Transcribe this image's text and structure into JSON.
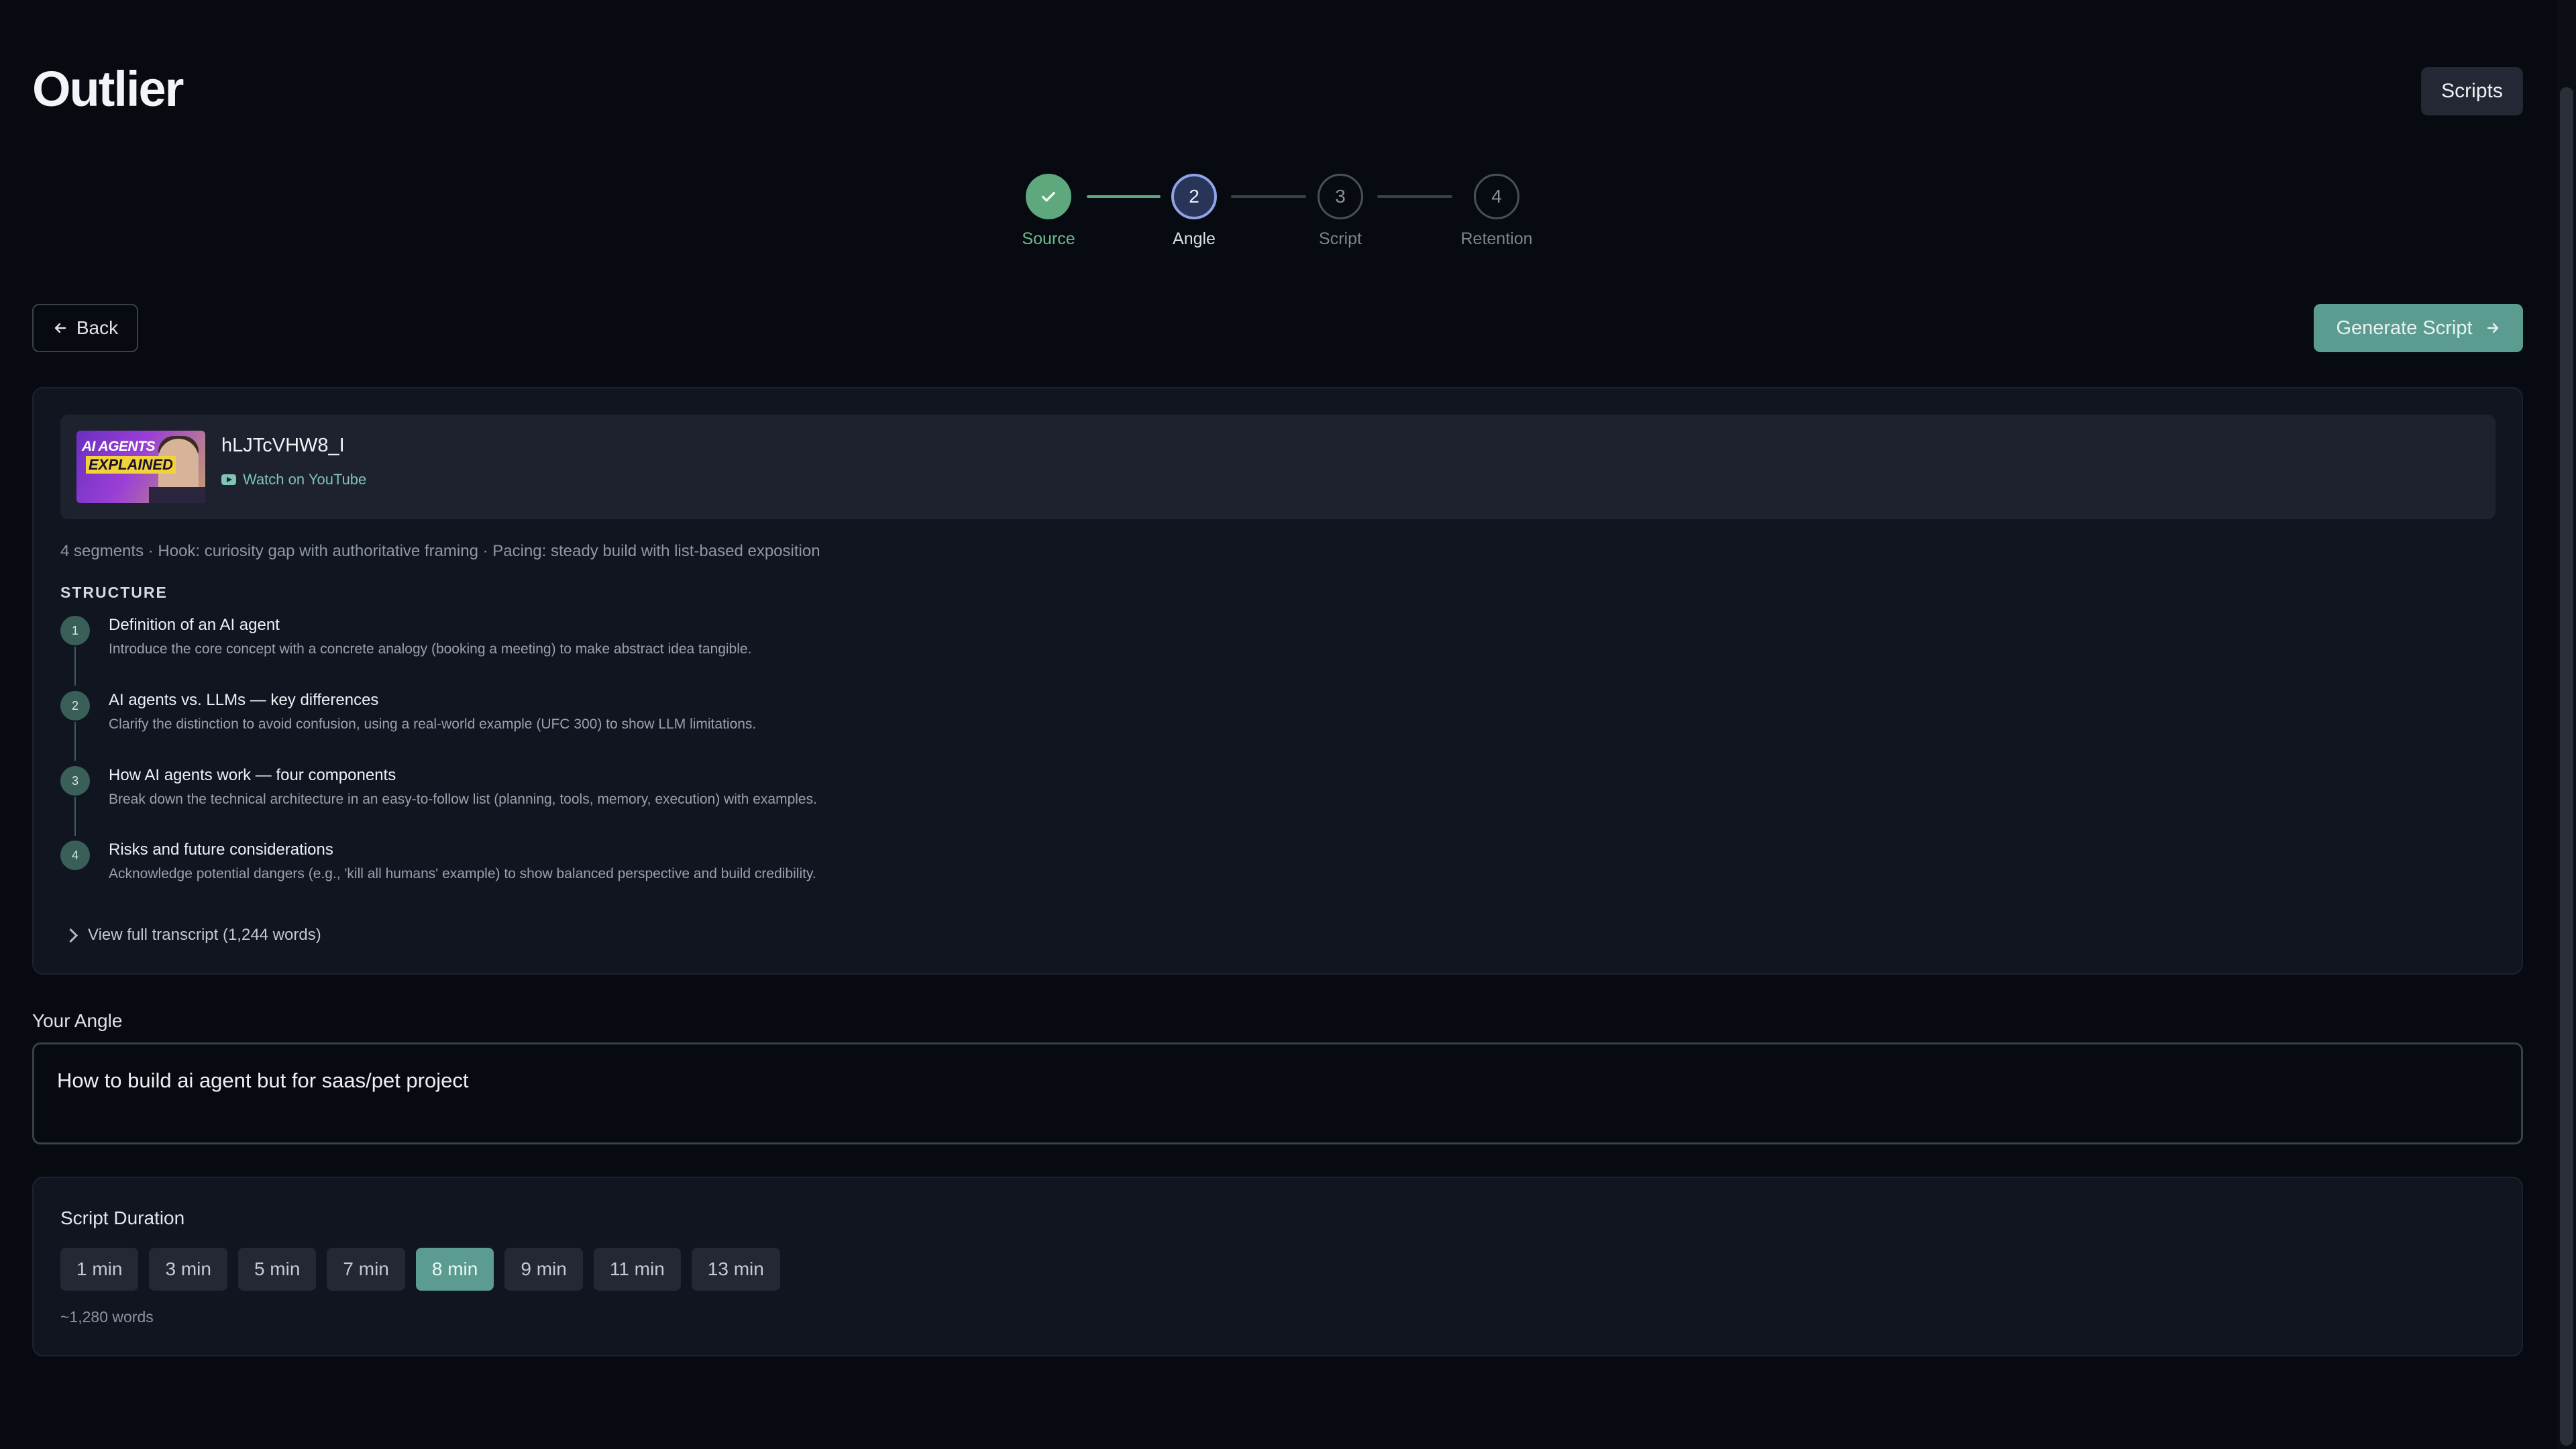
{
  "app": {
    "title": "Outlier",
    "scripts_label": "Scripts"
  },
  "stepper": {
    "steps": [
      {
        "num": "",
        "label": "Source",
        "state": "done"
      },
      {
        "num": "2",
        "label": "Angle",
        "state": "active"
      },
      {
        "num": "3",
        "label": "Script",
        "state": "pending"
      },
      {
        "num": "4",
        "label": "Retention",
        "state": "pending"
      }
    ]
  },
  "actions": {
    "back_label": "Back",
    "generate_label": "Generate Script"
  },
  "video": {
    "id": "hLJTcVHW8_I",
    "link_label": "Watch on YouTube",
    "thumb_line1": "AI AGENTS",
    "thumb_line2": "EXPLAINED"
  },
  "analysis": {
    "meta": "4 segments · Hook: curiosity gap with authoritative framing · Pacing: steady build with list-based exposition",
    "structure_title": "STRUCTURE",
    "segments": [
      {
        "num": "1",
        "title": "Definition of an AI agent",
        "desc": "Introduce the core concept with a concrete analogy (booking a meeting) to make abstract idea tangible."
      },
      {
        "num": "2",
        "title": "AI agents vs. LLMs — key differences",
        "desc": "Clarify the distinction to avoid confusion, using a real-world example (UFC 300) to show LLM limitations."
      },
      {
        "num": "3",
        "title": "How AI agents work — four components",
        "desc": "Break down the technical architecture in an easy-to-follow list (planning, tools, memory, execution) with examples."
      },
      {
        "num": "4",
        "title": "Risks and future considerations",
        "desc": "Acknowledge potential dangers (e.g., 'kill all humans' example) to show balanced perspective and build credibility."
      }
    ],
    "transcript_label": "View full transcript (1,244 words)"
  },
  "angle": {
    "label": "Your Angle",
    "value": "How to build ai agent but for saas/pet project"
  },
  "duration": {
    "title": "Script Duration",
    "options": [
      "1 min",
      "3 min",
      "5 min",
      "7 min",
      "8 min",
      "9 min",
      "11 min",
      "13 min"
    ],
    "selected": "8 min",
    "words": "~1,280 words"
  },
  "colors": {
    "accent": "#5c9c90",
    "done": "#5fa77c",
    "active_ring": "#8fa4e8",
    "background": "#070a11"
  }
}
